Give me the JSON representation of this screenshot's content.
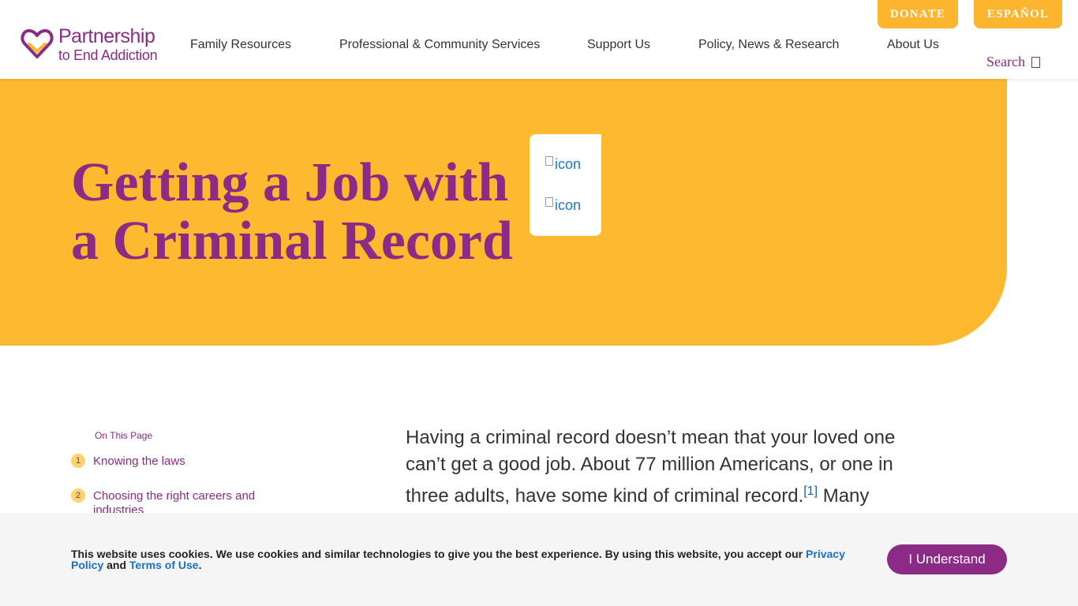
{
  "header": {
    "logo": {
      "line1": "Partnership",
      "line2": "to End Addiction"
    },
    "nav": [
      {
        "label": "Family Resources"
      },
      {
        "label": "Professional & Community Services"
      },
      {
        "label": "Support Us"
      },
      {
        "label": "Policy, News & Research"
      },
      {
        "label": "About Us"
      }
    ],
    "donate_label": "DONATE",
    "espanol_label": "ESPAÑOL",
    "search_label": "Search"
  },
  "hero": {
    "title_line1": "Getting a Job with",
    "title_line2": "a Criminal Record",
    "share_icons": [
      {
        "alt": "icon"
      },
      {
        "alt": "icon"
      }
    ]
  },
  "toc": {
    "heading": "On This Page",
    "items": [
      {
        "num": "1",
        "label": "Knowing the laws"
      },
      {
        "num": "2",
        "label": "Choosing the right careers and industries"
      }
    ]
  },
  "body": {
    "paragraph": "Having a criminal record doesn’t mean that your loved one can’t get a good job. About 77 million Americans, or one in three adults, have some kind of criminal record.",
    "footnote": "[1]",
    "paragraph_cont": " Many"
  },
  "cookie": {
    "text": "This website uses cookies. We use cookies and similar technologies to give you the best experience. By using this website, you accept our ",
    "privacy_link": "Privacy Policy",
    "and": " and ",
    "terms_link": "Terms of Use",
    "period": ".",
    "button_label": "I Understand"
  },
  "colors": {
    "brand_purple": "#8b2b86",
    "brand_yellow": "#fdb92f",
    "button_orange": "#fdb52f",
    "link_blue": "#1a72c4"
  }
}
